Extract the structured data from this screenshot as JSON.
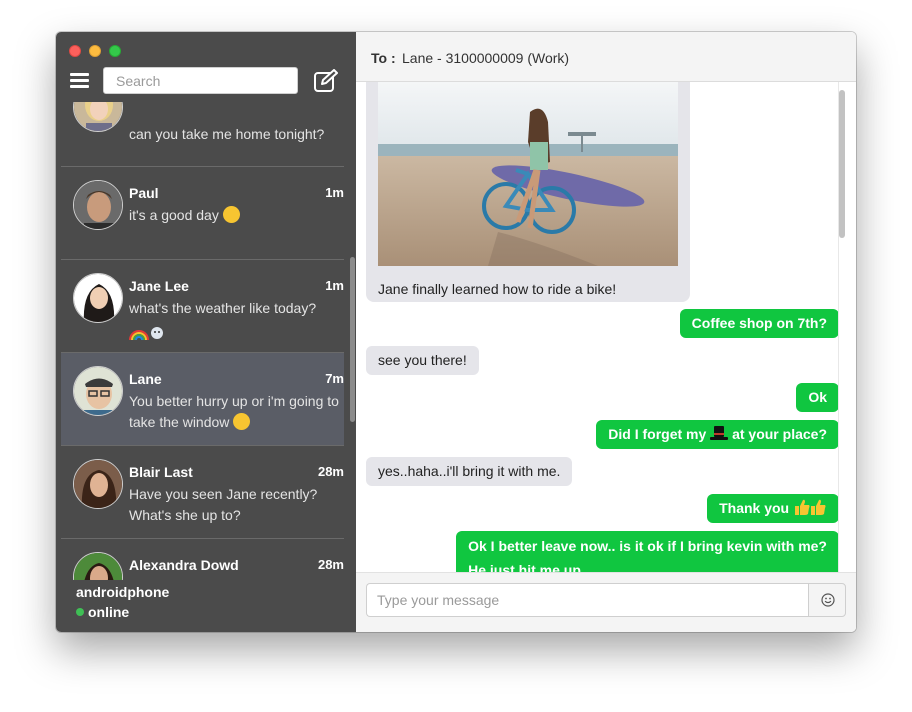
{
  "sidebar": {
    "search_placeholder": "Search",
    "conversations": [
      {
        "name": "",
        "time": "",
        "preview": "can you take me home tonight?"
      },
      {
        "name": "Paul",
        "time": "1m",
        "preview": "it's a good day"
      },
      {
        "name": "Jane Lee",
        "time": "1m",
        "preview": "what's the weather like today?"
      },
      {
        "name": "Lane",
        "time": "7m",
        "preview": "You better hurry up or i'm going to take the window"
      },
      {
        "name": "Blair Last",
        "time": "28m",
        "preview": "Have you seen Jane recently? What's she up to?"
      },
      {
        "name": "Alexandra Dowd",
        "time": "28m",
        "preview": ""
      }
    ],
    "presence": {
      "name": "androidphone",
      "status": "online",
      "status_color": "#3fbf55"
    }
  },
  "chat": {
    "to_label": "To :",
    "to_value": "Lane - 3100000009 (Work)",
    "photo_caption": "Jane finally learned how to ride a bike!",
    "messages": [
      {
        "direction": "out",
        "text": "Coffee shop on 7th?"
      },
      {
        "direction": "in",
        "text": "see you there!"
      },
      {
        "direction": "out",
        "text": "Ok"
      },
      {
        "direction": "out",
        "text_before": "Did I forget my",
        "text_after": "at your place?"
      },
      {
        "direction": "in",
        "text": "yes..haha..i'll bring it with me."
      },
      {
        "direction": "out",
        "text": "Thank you"
      },
      {
        "direction": "out",
        "text": "Ok I better leave now.. is it ok if I bring kevin with me?",
        "text2": "He just hit me up"
      }
    ],
    "composer_placeholder": "Type your message"
  },
  "colors": {
    "outgoing": "#10c640",
    "incoming": "#e5e5ea",
    "sidebar": "#4b4b4b",
    "active_row": "#5a5d66"
  },
  "icons": [
    "menu-icon",
    "compose-icon",
    "smiley-icon",
    "emoji-icon"
  ]
}
